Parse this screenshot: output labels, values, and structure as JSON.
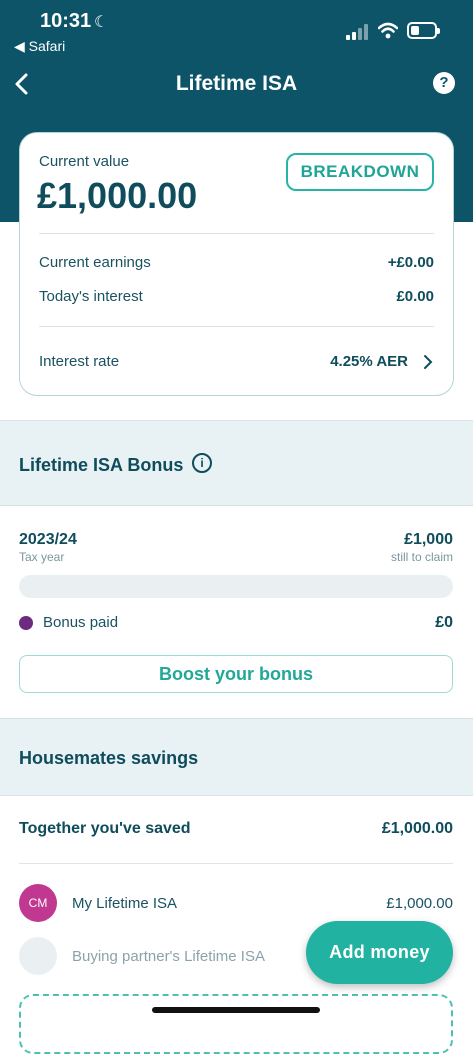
{
  "status_bar": {
    "time": "10:31",
    "back_app": "◀ Safari"
  },
  "nav": {
    "title": "Lifetime ISA"
  },
  "value_card": {
    "current_value_label": "Current value",
    "current_value": "£1,000.00",
    "breakdown_label": "BREAKDOWN",
    "current_earnings_label": "Current earnings",
    "current_earnings": "+£0.00",
    "todays_interest_label": "Today's interest",
    "todays_interest": "£0.00",
    "interest_rate_label": "Interest rate",
    "interest_rate": "4.25% AER"
  },
  "bonus": {
    "heading": "Lifetime ISA Bonus",
    "tax_year": "2023/24",
    "tax_year_label": "Tax year",
    "still_to_claim_amount": "£1,000",
    "still_to_claim_label": "still to claim",
    "progress_fraction": 0,
    "bonus_paid_label": "Bonus paid",
    "bonus_paid": "£0",
    "boost_label": "Boost your bonus"
  },
  "housemates": {
    "heading": "Housemates savings",
    "together_label": "Together you've saved",
    "together_value": "£1,000.00",
    "my_initials": "CM",
    "my_isa_label": "My Lifetime ISA",
    "my_isa_value": "£1,000.00",
    "partner_label": "Buying partner's Lifetime ISA"
  },
  "fab": {
    "add_money_label": "Add money"
  },
  "colors": {
    "header": "#0d5468",
    "accent": "#22b2a2",
    "bonus": "#6c2b7e",
    "avatar": "#c0388f"
  }
}
